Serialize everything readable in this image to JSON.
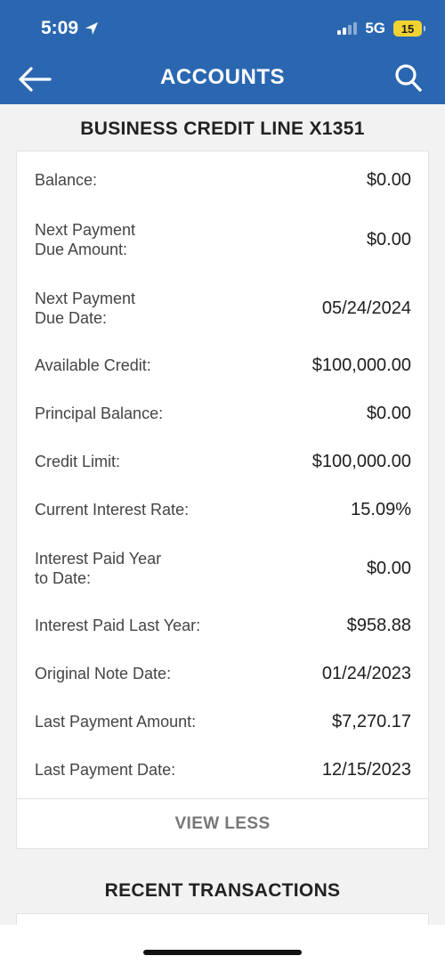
{
  "status_bar": {
    "time": "5:09",
    "network": "5G",
    "battery": "15"
  },
  "header": {
    "title": "ACCOUNTS"
  },
  "account": {
    "title": "BUSINESS CREDIT LINE X1351",
    "rows": [
      {
        "label": "Balance:",
        "value": "$0.00"
      },
      {
        "label": "Next Payment\nDue Amount:",
        "value": "$0.00"
      },
      {
        "label": "Next Payment\nDue Date:",
        "value": "05/24/2024"
      },
      {
        "label": "Available Credit:",
        "value": "$100,000.00"
      },
      {
        "label": "Principal Balance:",
        "value": "$0.00"
      },
      {
        "label": "Credit Limit:",
        "value": "$100,000.00"
      },
      {
        "label": "Current Interest Rate:",
        "value": "15.09%"
      },
      {
        "label": "Interest Paid Year\nto Date:",
        "value": "$0.00"
      },
      {
        "label": "Interest Paid Last Year:",
        "value": "$958.88"
      },
      {
        "label": "Original Note Date:",
        "value": "01/24/2023"
      },
      {
        "label": "Last Payment Amount:",
        "value": "$7,270.17"
      },
      {
        "label": "Last Payment Date:",
        "value": "12/15/2023"
      }
    ],
    "view_less_label": "VIEW LESS"
  },
  "recent": {
    "title": "RECENT TRANSACTIONS"
  },
  "icons": {
    "back": "arrow-left-icon",
    "search": "search-icon",
    "location": "location-arrow-icon",
    "signal": "signal-icon",
    "battery": "battery-icon"
  },
  "colors": {
    "header_bg": "#2b67b1",
    "battery": "#f2d233"
  }
}
